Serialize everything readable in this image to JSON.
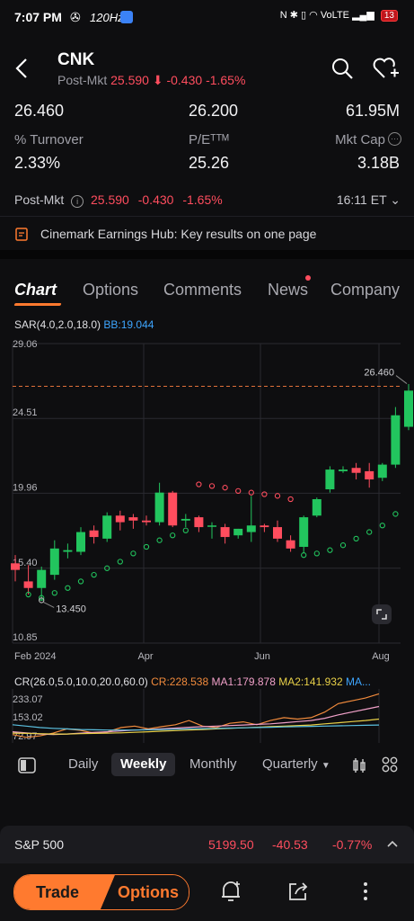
{
  "status_bar": {
    "time": "7:07 PM",
    "refresh_rate": "120Hz",
    "network": "VoLTE",
    "battery": "13"
  },
  "header": {
    "ticker": "CNK",
    "post_label": "Post-Mkt",
    "post_price": "25.590",
    "post_change": "-0.430",
    "post_pct": "-1.65%"
  },
  "stats": {
    "row1": [
      "26.460",
      "26.200",
      "61.95M"
    ],
    "labels": [
      "% Turnover",
      "P/Eᵀᵀᴹ",
      "Mkt Cap"
    ],
    "row2": [
      "2.33%",
      "25.26",
      "3.18B"
    ]
  },
  "post_market": {
    "label": "Post-Mkt",
    "price": "25.590",
    "change": "-0.430",
    "pct": "-1.65%",
    "time": "16:11 ET"
  },
  "hub_banner": "Cinemark Earnings Hub: Key results on one page",
  "tabs": [
    "Chart",
    "Options",
    "Comments",
    "News",
    "Company"
  ],
  "chart_data": {
    "type": "candlestick",
    "indicator_label": "SAR(4.0,2.0,18.0)",
    "bb_label": "BB:19.044",
    "y_ticks": [
      "29.06",
      "24.51",
      "19.96",
      "15.40",
      "10.85"
    ],
    "ylim": [
      10.85,
      29.06
    ],
    "x_ticks": [
      "Feb 2024",
      "Apr",
      "Jun",
      "Aug"
    ],
    "last_price_label": "26.460",
    "last_price": 26.46,
    "low_label": "13.450",
    "low_value": 13.45,
    "candles": [
      {
        "o": 15.7,
        "h": 16.2,
        "l": 14.6,
        "c": 15.3
      },
      {
        "o": 14.6,
        "h": 15.6,
        "l": 13.8,
        "c": 14.2
      },
      {
        "o": 14.2,
        "h": 15.5,
        "l": 13.45,
        "c": 15.3
      },
      {
        "o": 15.0,
        "h": 17.1,
        "l": 14.7,
        "c": 16.6
      },
      {
        "o": 16.4,
        "h": 16.9,
        "l": 16.0,
        "c": 16.5
      },
      {
        "o": 16.4,
        "h": 17.9,
        "l": 16.2,
        "c": 17.6
      },
      {
        "o": 17.7,
        "h": 18.0,
        "l": 16.9,
        "c": 17.3
      },
      {
        "o": 17.2,
        "h": 18.8,
        "l": 17.0,
        "c": 18.6
      },
      {
        "o": 18.6,
        "h": 18.9,
        "l": 17.7,
        "c": 18.2
      },
      {
        "o": 18.5,
        "h": 18.7,
        "l": 17.8,
        "c": 18.3
      },
      {
        "o": 18.3,
        "h": 18.6,
        "l": 18.0,
        "c": 18.2
      },
      {
        "o": 18.2,
        "h": 20.6,
        "l": 18.0,
        "c": 20.0
      },
      {
        "o": 20.0,
        "h": 20.1,
        "l": 17.9,
        "c": 18.0
      },
      {
        "o": 18.3,
        "h": 18.7,
        "l": 17.9,
        "c": 18.4
      },
      {
        "o": 18.5,
        "h": 18.6,
        "l": 17.6,
        "c": 17.9
      },
      {
        "o": 18.0,
        "h": 18.2,
        "l": 17.2,
        "c": 18.0
      },
      {
        "o": 17.9,
        "h": 18.1,
        "l": 16.9,
        "c": 17.3
      },
      {
        "o": 17.4,
        "h": 17.8,
        "l": 17.2,
        "c": 17.8
      },
      {
        "o": 17.6,
        "h": 19.8,
        "l": 17.0,
        "c": 18.0
      },
      {
        "o": 18.0,
        "h": 18.1,
        "l": 17.6,
        "c": 17.9
      },
      {
        "o": 17.9,
        "h": 18.3,
        "l": 17.0,
        "c": 17.2
      },
      {
        "o": 17.1,
        "h": 17.4,
        "l": 16.4,
        "c": 16.6
      },
      {
        "o": 16.7,
        "h": 18.6,
        "l": 16.3,
        "c": 18.5
      },
      {
        "o": 18.6,
        "h": 19.7,
        "l": 18.5,
        "c": 19.6
      },
      {
        "o": 20.2,
        "h": 21.6,
        "l": 20.0,
        "c": 21.4
      },
      {
        "o": 21.3,
        "h": 21.6,
        "l": 21.2,
        "c": 21.4
      },
      {
        "o": 21.5,
        "h": 21.8,
        "l": 20.8,
        "c": 21.2
      },
      {
        "o": 21.3,
        "h": 21.8,
        "l": 20.3,
        "c": 20.8
      },
      {
        "o": 20.9,
        "h": 21.8,
        "l": 20.7,
        "c": 21.7
      },
      {
        "o": 21.7,
        "h": 25.2,
        "l": 21.5,
        "c": 24.7
      },
      {
        "o": 24.0,
        "h": 26.6,
        "l": 23.8,
        "c": 26.2
      }
    ],
    "sar": [
      {
        "i": 1,
        "v": 13.8
      },
      {
        "i": 2,
        "v": 13.6
      },
      {
        "i": 3,
        "v": 13.9
      },
      {
        "i": 4,
        "v": 14.2
      },
      {
        "i": 5,
        "v": 14.6
      },
      {
        "i": 6,
        "v": 15.0
      },
      {
        "i": 7,
        "v": 15.4
      },
      {
        "i": 8,
        "v": 15.8
      },
      {
        "i": 9,
        "v": 16.3
      },
      {
        "i": 10,
        "v": 16.7
      },
      {
        "i": 11,
        "v": 17.1
      },
      {
        "i": 12,
        "v": 17.4
      },
      {
        "i": 13,
        "v": 17.7
      },
      {
        "i": 14,
        "v": 20.5
      },
      {
        "i": 15,
        "v": 20.4
      },
      {
        "i": 16,
        "v": 20.3
      },
      {
        "i": 17,
        "v": 20.1
      },
      {
        "i": 18,
        "v": 20.0
      },
      {
        "i": 19,
        "v": 19.9
      },
      {
        "i": 20,
        "v": 19.8
      },
      {
        "i": 21,
        "v": 19.6
      },
      {
        "i": 22,
        "v": 16.2
      },
      {
        "i": 23,
        "v": 16.3
      },
      {
        "i": 24,
        "v": 16.5
      },
      {
        "i": 25,
        "v": 16.8
      },
      {
        "i": 26,
        "v": 17.2
      },
      {
        "i": 27,
        "v": 17.6
      },
      {
        "i": 28,
        "v": 18.0
      },
      {
        "i": 29,
        "v": 18.7
      }
    ],
    "cr": {
      "label": "CR(26.0,5.0,10.0,20.0,60.0)",
      "cr_value": "CR:228.538",
      "ma1": "MA1:179.878",
      "ma2": "MA2:141.932",
      "ma3": "MA...",
      "y_ticks": [
        "233.07",
        "153.02",
        "72.97"
      ],
      "ylim": [
        72.97,
        233.07
      ],
      "series": [
        {
          "name": "CR",
          "color": "#f08a3c",
          "values": [
            90,
            80,
            85,
            95,
            110,
            105,
            95,
            100,
            115,
            120,
            110,
            118,
            125,
            140,
            120,
            115,
            130,
            135,
            125,
            140,
            150,
            145,
            150,
            170,
            200,
            210,
            220,
            235
          ]
        },
        {
          "name": "MA1",
          "color": "#f0a0c8",
          "values": [
            100,
            96,
            92,
            90,
            92,
            95,
            98,
            100,
            103,
            106,
            108,
            110,
            113,
            116,
            118,
            120,
            122,
            124,
            126,
            128,
            132,
            136,
            140,
            148,
            160,
            170,
            180,
            190
          ]
        },
        {
          "name": "MA2",
          "color": "#e8d048",
          "values": [
            95,
            94,
            93,
            92,
            92,
            93,
            94,
            95,
            96,
            98,
            100,
            102,
            104,
            106,
            108,
            110,
            112,
            114,
            116,
            118,
            120,
            122,
            124,
            128,
            132,
            136,
            140,
            145
          ]
        },
        {
          "name": "MA3",
          "color": "#5bc0e0",
          "values": [
            125,
            120,
            115,
            112,
            110,
            108,
            107,
            106,
            106,
            106,
            107,
            108,
            109,
            110,
            111,
            112,
            113,
            114,
            115,
            116,
            117,
            118,
            119,
            120,
            121,
            122,
            123,
            124
          ]
        }
      ]
    }
  },
  "periods": [
    "Daily",
    "Weekly",
    "Monthly",
    "Quarterly"
  ],
  "active_period": "Weekly",
  "index_bar": {
    "name": "S&P 500",
    "value": "5199.50",
    "change": "-40.53",
    "pct": "-0.77%"
  },
  "bottom_bar": {
    "trade": "Trade",
    "options": "Options"
  },
  "colors": {
    "up": "#22c55e",
    "down": "#ff4d5e",
    "accent": "#ff7a2f",
    "blue": "#3ea6ff"
  }
}
